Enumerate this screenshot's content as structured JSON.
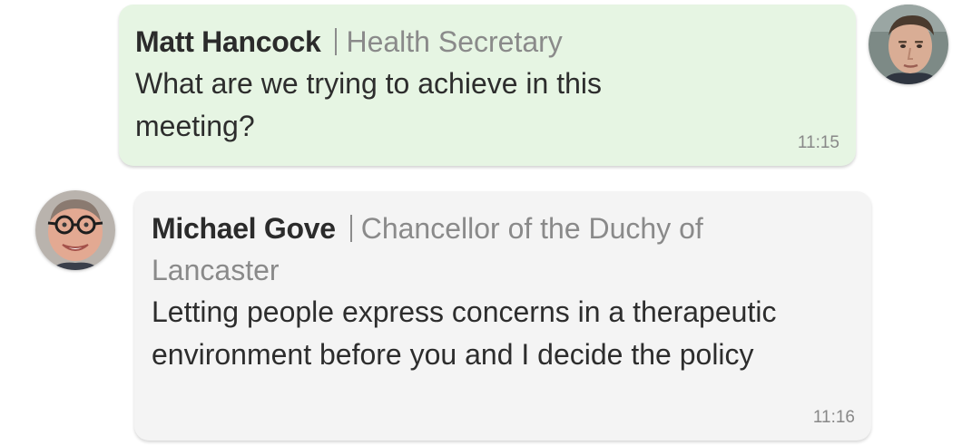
{
  "messages": [
    {
      "sender": "Matt Hancock",
      "role": "Health Secretary",
      "text": "What are we trying to achieve in this meeting?",
      "time": "11:15"
    },
    {
      "sender": "Michael Gove",
      "role": "Chancellor of the Duchy of Lancaster",
      "text": "Letting people express concerns in a therapeutic environment before you and I decide the policy",
      "time": "11:16"
    }
  ],
  "colors": {
    "outgoing_bubble": "#e6f5e3",
    "incoming_bubble": "#f4f4f4",
    "role_text": "#8a8a8a",
    "timestamp": "#888888"
  },
  "icons": {
    "avatar_1": "portrait-photo",
    "avatar_2": "portrait-photo"
  }
}
